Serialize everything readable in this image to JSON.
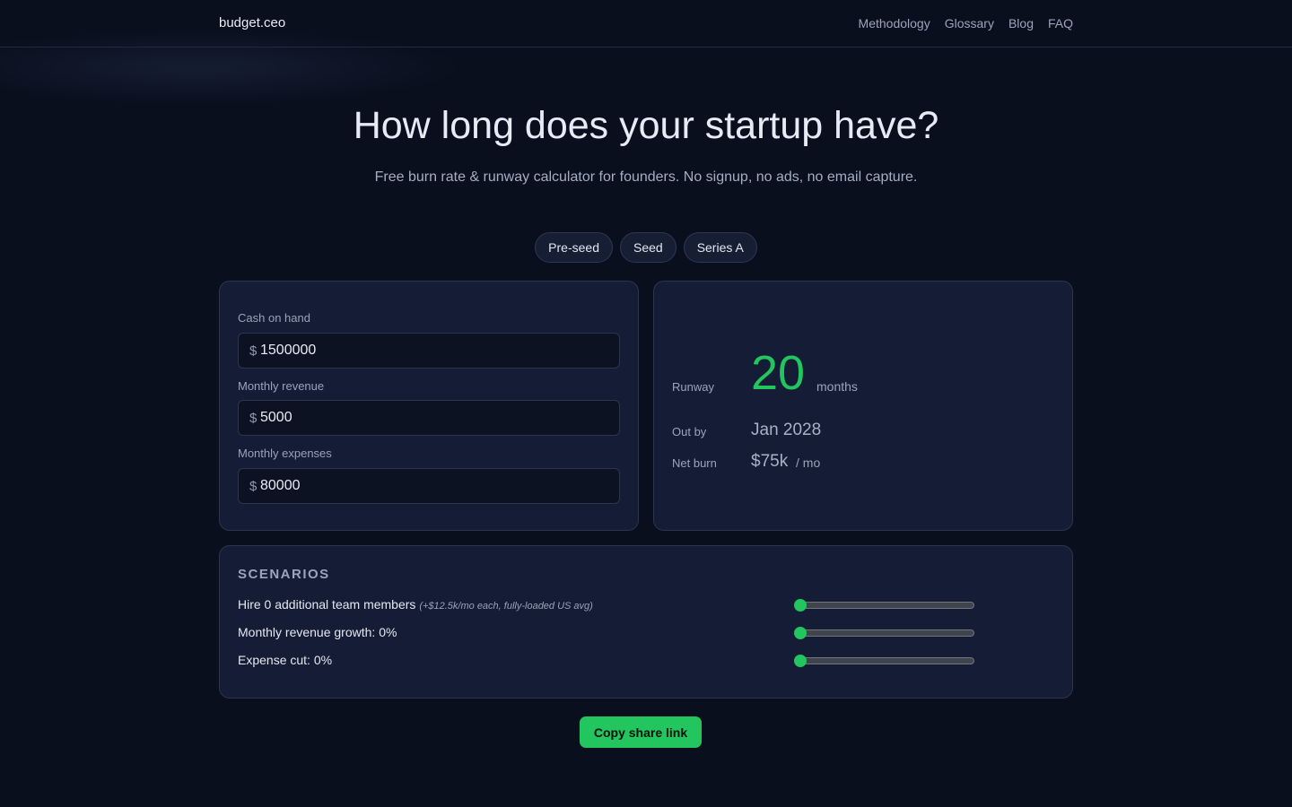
{
  "header": {
    "brand": "budget.ceo",
    "nav": [
      "Methodology",
      "Glossary",
      "Blog",
      "FAQ"
    ]
  },
  "hero": {
    "title": "How long does your startup have?",
    "subtitle": "Free burn rate & runway calculator for founders. No signup, no ads, no email capture."
  },
  "presets": [
    "Pre-seed",
    "Seed",
    "Series A"
  ],
  "inputs": {
    "currency_symbol": "$",
    "cash": {
      "label": "Cash on hand",
      "value": "1500000"
    },
    "revenue": {
      "label": "Monthly revenue",
      "value": "5000"
    },
    "expenses": {
      "label": "Monthly expenses",
      "value": "80000"
    }
  },
  "results": {
    "runway_label": "Runway",
    "runway_value": "20",
    "runway_unit": "months",
    "out_by_label": "Out by",
    "out_by_value": "Jan 2028",
    "net_burn_label": "Net burn",
    "net_burn_value": "$75k",
    "net_burn_unit": "/ mo"
  },
  "scenarios": {
    "title": "SCENARIOS",
    "rows": [
      {
        "label": "Hire 0 additional team members",
        "note": "(+$12.5k/mo each, fully-loaded US avg)",
        "level": 0
      },
      {
        "label": "Monthly revenue growth: 0%",
        "note": "",
        "level": 0
      },
      {
        "label": "Expense cut: 0%",
        "note": "",
        "level": 0
      }
    ]
  },
  "actions": {
    "copy_label": "Copy share link"
  },
  "colors": {
    "accent": "#22c55e",
    "background": "#0a0f1d",
    "card": "#141d35"
  }
}
